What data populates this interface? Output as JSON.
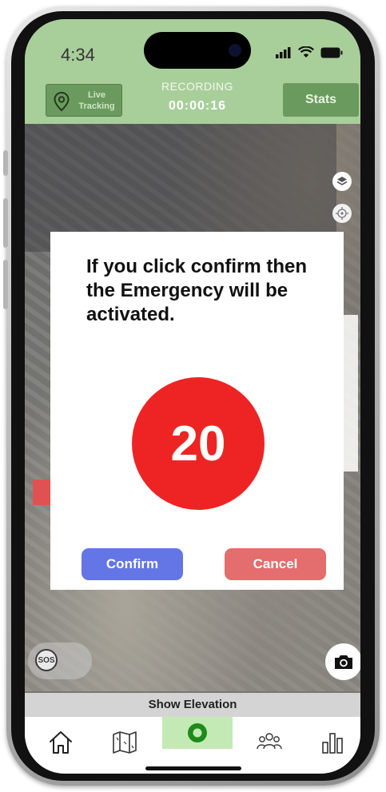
{
  "status_bar": {
    "time": "4:34"
  },
  "header": {
    "live_tracking_label": "Live\nTracking",
    "recording_label": "RECORDING",
    "recording_time": "00:00:16",
    "stats_label": "Stats"
  },
  "modal": {
    "message": "If you click confirm then the Emergency will be activated.",
    "countdown": "20",
    "confirm_label": "Confirm",
    "cancel_label": "Cancel"
  },
  "map": {
    "sos_label": "SOS",
    "show_elevation_label": "Show Elevation"
  },
  "nav": {
    "items": [
      "home-icon",
      "map-icon",
      "record-icon",
      "group-icon",
      "chart-icon"
    ],
    "active": "record-icon"
  },
  "colors": {
    "header_bg": "#a8cf9a",
    "header_button_bg": "#6a9a5d",
    "countdown_red": "#ee2424",
    "confirm_blue": "#6475e6",
    "cancel_red": "#e46d6d",
    "nav_active_bg": "#c3eab4"
  }
}
